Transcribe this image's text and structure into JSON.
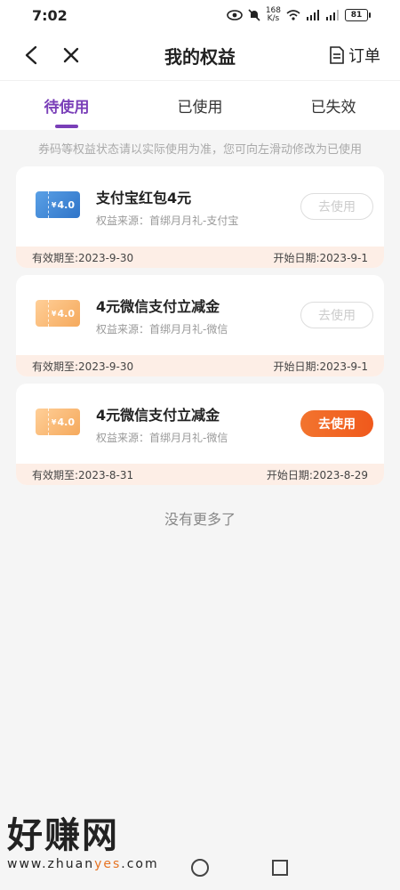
{
  "status_bar": {
    "time": "7:02",
    "speed_top": "168",
    "speed_bottom": "K/s",
    "signal1": "4G",
    "signal2": "4G",
    "battery": "81"
  },
  "header": {
    "title": "我的权益",
    "order_label": "订单"
  },
  "tabs": [
    {
      "label": "待使用",
      "active": true
    },
    {
      "label": "已使用",
      "active": false
    },
    {
      "label": "已失效",
      "active": false
    }
  ],
  "notice": "券码等权益状态请以实际使用为准，您可向左滑动修改为已使用",
  "cards": [
    {
      "title": "支付宝红包4元",
      "source": "权益来源：首绑月月礼-支付宝",
      "coupon_value": "4.0",
      "coupon_color": "blue",
      "button": "去使用",
      "button_enabled": false,
      "expiry": "有效期至:2023-9-30",
      "start": "开始日期:2023-9-1"
    },
    {
      "title": "4元微信支付立减金",
      "source": "权益来源：首绑月月礼-微信",
      "coupon_value": "4.0",
      "coupon_color": "orange",
      "button": "去使用",
      "button_enabled": false,
      "expiry": "有效期至:2023-9-30",
      "start": "开始日期:2023-9-1"
    },
    {
      "title": "4元微信支付立减金",
      "source": "权益来源：首绑月月礼-微信",
      "coupon_value": "4.0",
      "coupon_color": "orange",
      "button": "去使用",
      "button_enabled": true,
      "expiry": "有效期至:2023-8-31",
      "start": "开始日期:2023-8-29"
    }
  ],
  "no_more": "没有更多了",
  "watermark": {
    "big": "好赚网",
    "small_pre": "www.zhuan",
    "small_accent": "yes",
    "small_post": ".com"
  },
  "colors": {
    "accent": "#7a3fb8",
    "button": "#f0591c",
    "footer_bg": "#fdeee6"
  }
}
